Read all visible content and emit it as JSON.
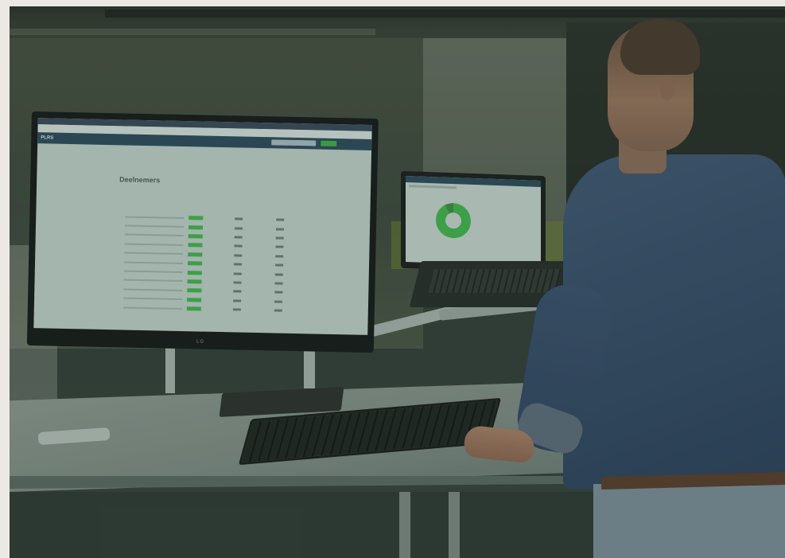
{
  "scene": {
    "description_tags": [
      "standing-desk",
      "monitor",
      "laptop",
      "keyboard",
      "person"
    ],
    "monitor": {
      "brand_logo": "LG",
      "app": {
        "brand": "PLRS",
        "page_title": "Deelnemers",
        "rows": 11
      }
    },
    "laptop": {
      "donut_fraction": 0.92
    },
    "colors": {
      "accent_green": "#43b54c",
      "nav_dark": "#2c4a5b",
      "shirt": "#3a506d"
    }
  }
}
